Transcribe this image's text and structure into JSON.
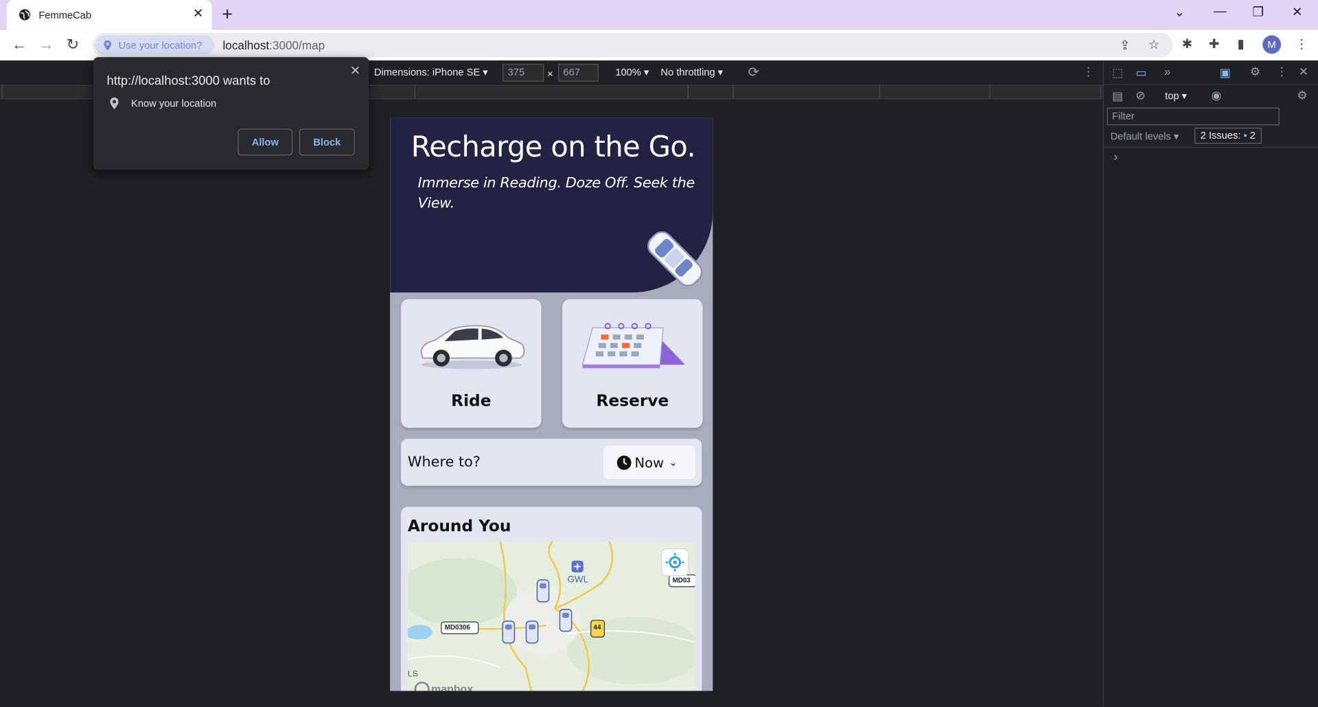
{
  "browser": {
    "tab_title": "FemmeCab",
    "tab_close": "✕",
    "new_tab": "+",
    "location_chip": "Use your location?",
    "url_host": "localhost",
    "url_path": ":3000/map",
    "avatar_letter": "M"
  },
  "permission_popup": {
    "title": "http://localhost:3000 wants to",
    "permission": "Know your location",
    "allow_label": "Allow",
    "block_label": "Block",
    "close": "✕"
  },
  "device_toolbar": {
    "dimensions_label": "Dimensions: iPhone SE ▾",
    "width": "375",
    "height": "667",
    "times": "×",
    "zoom": "100% ▾",
    "throttling": "No throttling ▾"
  },
  "app": {
    "hero_title": "Recharge on the Go.",
    "hero_subtitle": "Immerse in Reading. Doze Off. Seek the View.",
    "ride_label": "Ride",
    "reserve_label": "Reserve",
    "where_to": "Where to?",
    "now_label": "Now",
    "around_title": "Around You",
    "map_labels": {
      "airport": "GWL",
      "road1": "MD0306",
      "road2": "MD03",
      "highway": "44",
      "edge_text": "LS",
      "attribution": "mapbox"
    }
  },
  "devtools": {
    "context": "top ▾",
    "filter_placeholder": "Filter",
    "levels": "Default levels ▾",
    "issues_label": "2 Issues:",
    "issues_count": "2",
    "prompt": "›"
  },
  "colors": {
    "hero_bg": "#222342",
    "card_bg": "#e4e5f3",
    "tab_bar": "#e3d4f7",
    "link_blue": "#8ab4f8"
  }
}
